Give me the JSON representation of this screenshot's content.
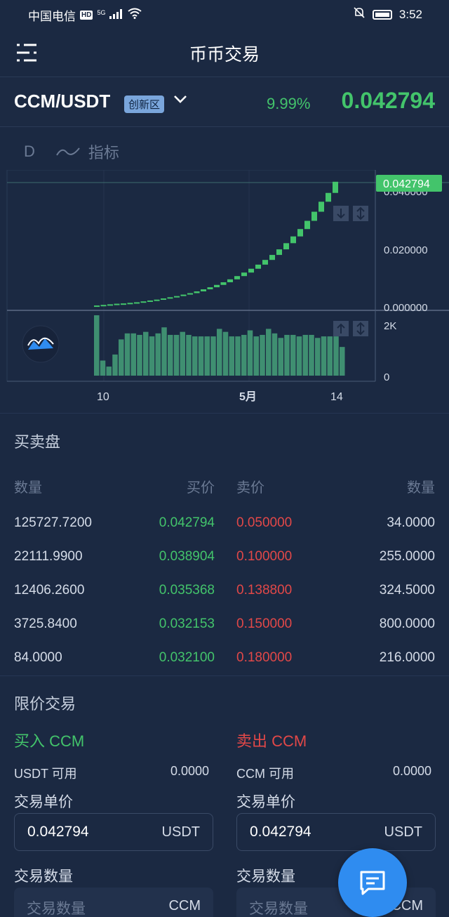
{
  "statusbar": {
    "carrier": "中国电信",
    "hd": "HD",
    "net": "5G",
    "time": "3:52"
  },
  "nav": {
    "title": "币币交易"
  },
  "pair": {
    "name": "CCM/USDT",
    "zone": "创新区",
    "change_pct": "9.99%",
    "price": "0.042794"
  },
  "chart_tabs": {
    "interval": "D",
    "indicator": "指标"
  },
  "chart_data": {
    "type": "bar",
    "title": "",
    "last_price_label": "0.042794",
    "price_ticks": [
      "0.040000",
      "0.020000",
      "0.000000"
    ],
    "volume_ticks": [
      "2K",
      "0"
    ],
    "x_ticks": [
      "10",
      "5月",
      "14"
    ],
    "candles_close": [
      0.0007,
      0.0009,
      0.0011,
      0.0013,
      0.0014,
      0.0016,
      0.0018,
      0.0021,
      0.0024,
      0.0027,
      0.0031,
      0.0035,
      0.0039,
      0.0044,
      0.0049,
      0.0055,
      0.0062,
      0.0069,
      0.0077,
      0.0086,
      0.0096,
      0.0107,
      0.0119,
      0.0132,
      0.0146,
      0.0162,
      0.0179,
      0.0198,
      0.0219,
      0.0242,
      0.0267,
      0.0295,
      0.0326,
      0.036,
      0.039,
      0.0428
    ],
    "volumes": [
      2000,
      500,
      300,
      700,
      1200,
      1400,
      1400,
      1350,
      1450,
      1300,
      1400,
      1600,
      1350,
      1350,
      1450,
      1350,
      1300,
      1300,
      1300,
      1300,
      1550,
      1450,
      1300,
      1300,
      1350,
      1500,
      1300,
      1350,
      1550,
      1400,
      1250,
      1350,
      1350,
      1300,
      1350,
      1350,
      1250,
      1300,
      1300,
      1300,
      950
    ],
    "vol_ylim": [
      0,
      2000
    ],
    "price_ylim": [
      0,
      0.043
    ]
  },
  "orderbook": {
    "title": "买卖盘",
    "headers": {
      "bid_qty": "数量",
      "bid_price": "买价",
      "ask_price": "卖价",
      "ask_qty": "数量"
    },
    "rows": [
      {
        "bid_qty": "125727.7200",
        "bid_price": "0.042794",
        "ask_price": "0.050000",
        "ask_qty": "34.0000"
      },
      {
        "bid_qty": "22111.9900",
        "bid_price": "0.038904",
        "ask_price": "0.100000",
        "ask_qty": "255.0000"
      },
      {
        "bid_qty": "12406.2600",
        "bid_price": "0.035368",
        "ask_price": "0.138800",
        "ask_qty": "324.5000"
      },
      {
        "bid_qty": "3725.8400",
        "bid_price": "0.032153",
        "ask_price": "0.150000",
        "ask_qty": "800.0000"
      },
      {
        "bid_qty": "84.0000",
        "bid_price": "0.032100",
        "ask_price": "0.180000",
        "ask_qty": "216.0000"
      }
    ]
  },
  "limit": {
    "title": "限价交易",
    "buy": {
      "title": "买入 CCM",
      "avail_label": "USDT 可用",
      "avail_value": "0.0000",
      "price_label": "交易单价",
      "price_value": "0.042794",
      "price_unit": "USDT",
      "qty_label": "交易数量",
      "qty_placeholder": "交易数量",
      "qty_unit": "CCM"
    },
    "sell": {
      "title": "卖出 CCM",
      "avail_label": "CCM 可用",
      "avail_value": "0.0000",
      "price_label": "交易单价",
      "price_value": "0.042794",
      "price_unit": "USDT",
      "qty_label": "交易数量",
      "qty_placeholder": "交易数量",
      "qty_unit": "CCM"
    }
  },
  "colors": {
    "bg": "#1b2942",
    "up": "#43c46b",
    "down": "#e24848",
    "accent": "#2f8cf0"
  }
}
